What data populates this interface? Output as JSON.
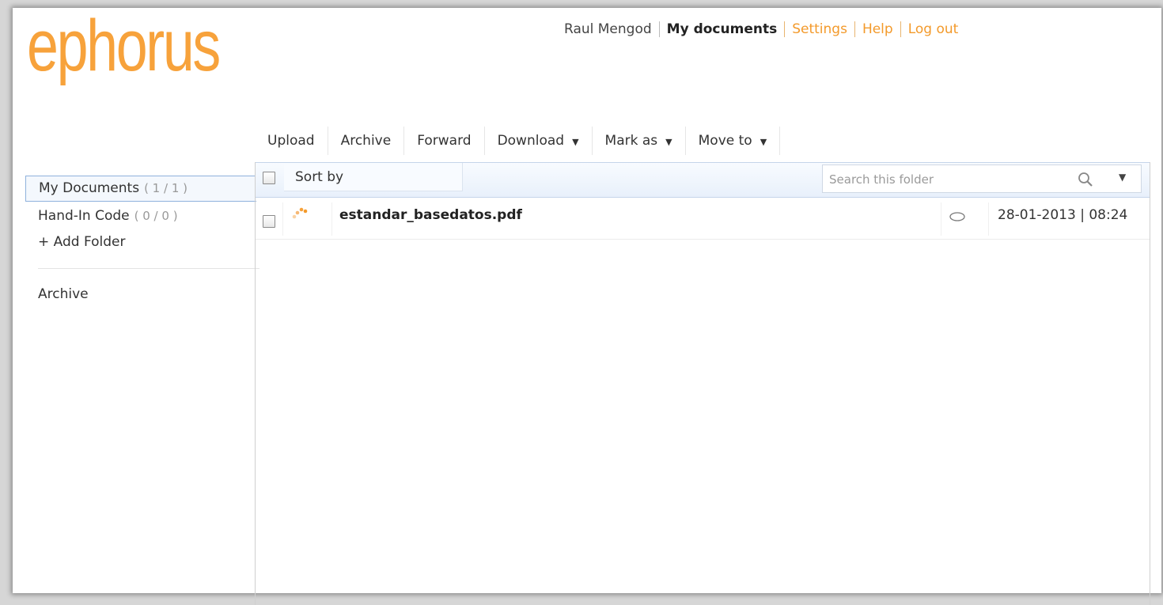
{
  "brand": {
    "logo_text": "ephorus",
    "logo_color": "#f7a23b"
  },
  "topnav": {
    "user": "Raul Mengod",
    "current": "My documents",
    "settings": "Settings",
    "help": "Help",
    "logout": "Log out",
    "link_color": "#f39a2b"
  },
  "toolbar": {
    "upload": "Upload",
    "archive": "Archive",
    "forward": "Forward",
    "download": "Download",
    "mark_as": "Mark as",
    "move_to": "Move to"
  },
  "sidebar": {
    "items": [
      {
        "label": "My Documents",
        "count": "( 1 / 1 )",
        "active": true
      },
      {
        "label": "Hand-In Code",
        "count": "( 0 / 0 )",
        "active": false
      }
    ],
    "add_folder": "+ Add Folder",
    "archive": "Archive"
  },
  "list": {
    "sort_by": "Sort by",
    "search_placeholder": "Search this folder",
    "rows": [
      {
        "filename": "estandar_basedatos.pdf",
        "datetime": "28-01-2013 | 08:24"
      }
    ]
  },
  "icons": [
    "dropdown-caret-icon",
    "magnifier-icon",
    "eye-icon",
    "status-dots-icon",
    "checkbox"
  ]
}
